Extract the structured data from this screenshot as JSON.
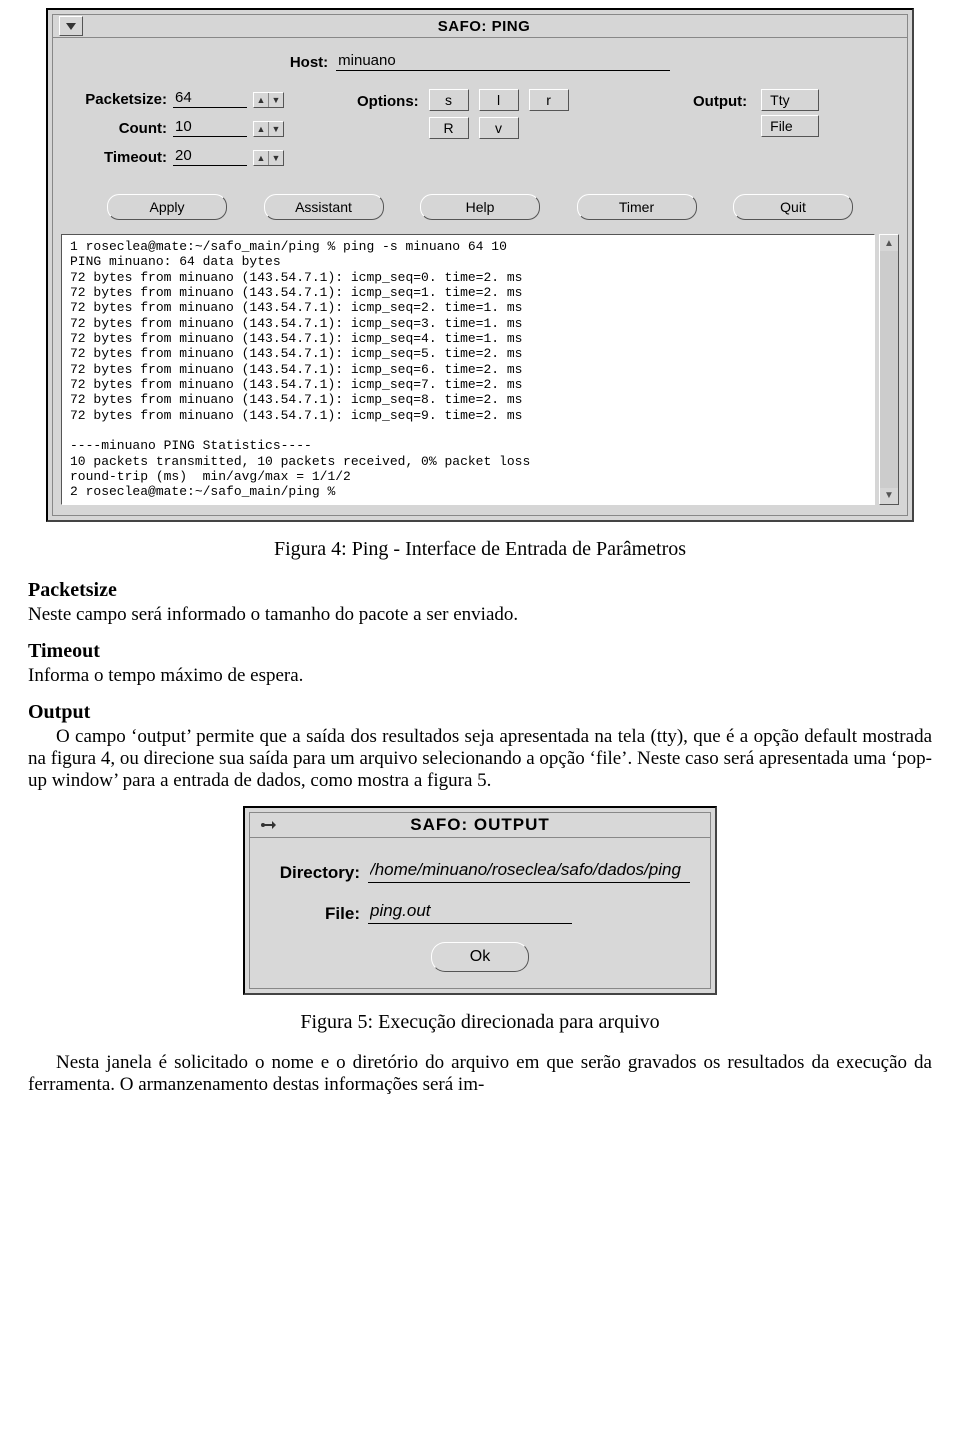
{
  "safo_ping": {
    "title": "SAFO: PING",
    "host_label": "Host:",
    "host_value": "minuano",
    "packetsize_label": "Packetsize:",
    "packetsize_value": "64",
    "count_label": "Count:",
    "count_value": "10",
    "timeout_label": "Timeout:",
    "timeout_value": "20",
    "options_label": "Options:",
    "options": {
      "a": "s",
      "b": "l",
      "c": "r",
      "d": "R",
      "e": "v"
    },
    "output_label": "Output:",
    "output_choices": {
      "tty": "Tty",
      "file": "File"
    },
    "buttons": {
      "apply": "Apply",
      "assistant": "Assistant",
      "help": "Help",
      "timer": "Timer",
      "quit": "Quit"
    },
    "terminal_lines": [
      "1 roseclea@mate:~/safo_main/ping % ping -s minuano 64 10",
      "PING minuano: 64 data bytes",
      "72 bytes from minuano (143.54.7.1): icmp_seq=0. time=2. ms",
      "72 bytes from minuano (143.54.7.1): icmp_seq=1. time=2. ms",
      "72 bytes from minuano (143.54.7.1): icmp_seq=2. time=1. ms",
      "72 bytes from minuano (143.54.7.1): icmp_seq=3. time=1. ms",
      "72 bytes from minuano (143.54.7.1): icmp_seq=4. time=1. ms",
      "72 bytes from minuano (143.54.7.1): icmp_seq=5. time=2. ms",
      "72 bytes from minuano (143.54.7.1): icmp_seq=6. time=2. ms",
      "72 bytes from minuano (143.54.7.1): icmp_seq=7. time=2. ms",
      "72 bytes from minuano (143.54.7.1): icmp_seq=8. time=2. ms",
      "72 bytes from minuano (143.54.7.1): icmp_seq=9. time=2. ms",
      "",
      "----minuano PING Statistics----",
      "10 packets transmitted, 10 packets received, 0% packet loss",
      "round-trip (ms)  min/avg/max = 1/1/2",
      "2 roseclea@mate:~/safo_main/ping %"
    ]
  },
  "text": {
    "caption1": "Figura 4: Ping - Interface de Entrada de Parâmetros",
    "packetsize_head": "Packetsize",
    "packetsize_body": "Neste campo será informado o tamanho do pacote a ser enviado.",
    "timeout_head": "Timeout",
    "timeout_body": "Informa o tempo máximo de espera.",
    "output_head": "Output",
    "output_body": "O campo ‘output’ permite que a saída dos resultados seja apresentada na tela (tty), que é a opção default mostrada na figura 4, ou direcione sua saída para um arquivo selecionando a opção ‘file’. Neste caso será apresentada uma ‘pop-up window’ para a entrada de dados, como mostra a figura 5.",
    "caption2": "Figura 5: Execução direcionada para arquivo",
    "final_para": "Nesta janela é solicitado o nome e o diretório do arquivo em que serão gravados os resultados da execução da ferramenta. O armanzenamento destas informações será im-"
  },
  "safo_output": {
    "title": "SAFO: OUTPUT",
    "directory_label": "Directory:",
    "directory_value": "/home/minuano/roseclea/safo/dados/ping",
    "file_label": "File:",
    "file_value": "ping.out",
    "ok_label": "Ok"
  }
}
